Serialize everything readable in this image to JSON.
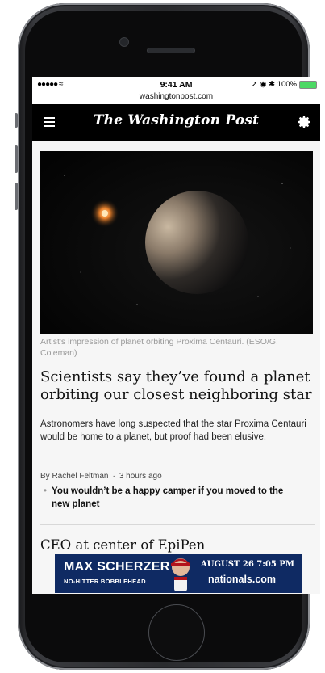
{
  "status_bar": {
    "signal": "●●●●● ≈",
    "time": "9:41 AM",
    "right_status": "➚ ◉ ✱ 100%",
    "battery_level": 1.0
  },
  "browser": {
    "url": "washingtonpost.com"
  },
  "header": {
    "masthead": "The Washington Post"
  },
  "lead_story": {
    "image_caption": "Artist's impression of planet orbiting Proxima Centauri. (ESO/G. Coleman)",
    "headline": "Scientists say they’ve found a planet orbiting our closest neighboring star",
    "summary": "Astronomers have long suspected that the star Proxima Centauri would be home to a planet, but proof had been elusive.",
    "author": "By Rachel Feltman",
    "time_ago": "3 hours ago",
    "related_link": "You wouldn’t be a happy camper if you moved to the new planet"
  },
  "next_story": {
    "headline": "CEO at center of EpiPen"
  },
  "ad": {
    "name": "MAX SCHERZER",
    "subtitle": "NO-HITTER BOBBLEHEAD",
    "date": "AUGUST 26 7:05 PM",
    "site": "nationals.com"
  },
  "colors": {
    "navbar": "#000000",
    "ad_background": "#0f2a63",
    "battery": "#4cd964"
  }
}
